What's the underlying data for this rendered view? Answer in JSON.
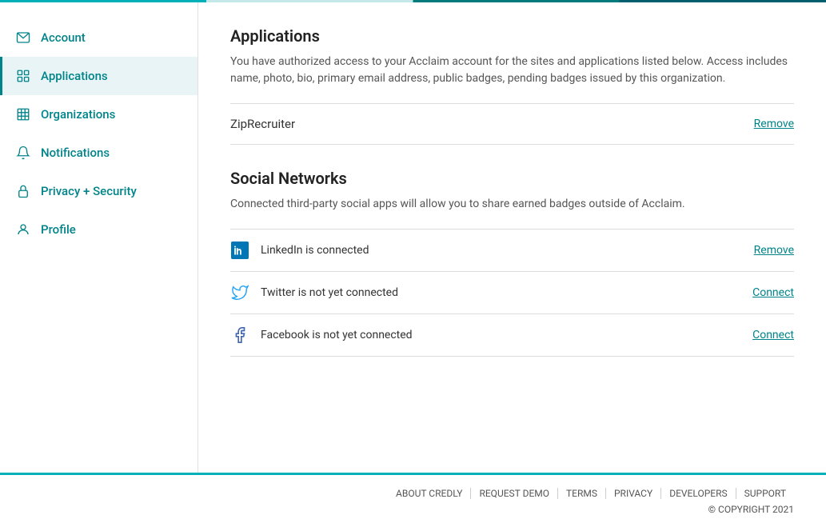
{
  "sidebar": {
    "items": [
      {
        "label": "Account",
        "icon": "mail-icon",
        "active": false,
        "id": "account"
      },
      {
        "label": "Applications",
        "icon": "grid-icon",
        "active": true,
        "id": "applications"
      },
      {
        "label": "Organizations",
        "icon": "building-icon",
        "active": false,
        "id": "organizations"
      },
      {
        "label": "Notifications",
        "icon": "bell-icon",
        "active": false,
        "id": "notifications"
      },
      {
        "label": "Privacy + Security",
        "icon": "lock-icon",
        "active": false,
        "id": "privacy-security"
      },
      {
        "label": "Profile",
        "icon": "user-icon",
        "active": false,
        "id": "profile"
      }
    ]
  },
  "main": {
    "applications_title": "Applications",
    "applications_desc": "You have authorized access to your Acclaim account for the sites and applications listed below. Access includes name, photo, bio, primary email address, public badges, pending badges issued by this organization.",
    "authorized_apps": [
      {
        "name": "ZipRecruiter",
        "action": "Remove"
      }
    ],
    "social_networks_title": "Social Networks",
    "social_networks_desc": "Connected third-party social apps will allow you to share earned badges outside of Acclaim.",
    "social_items": [
      {
        "platform": "LinkedIn",
        "status": "LinkedIn is connected",
        "action": "Remove",
        "connected": true
      },
      {
        "platform": "Twitter",
        "status": "Twitter is not yet connected",
        "action": "Connect",
        "connected": false
      },
      {
        "platform": "Facebook",
        "status": "Facebook is not yet connected",
        "action": "Connect",
        "connected": false
      }
    ]
  },
  "footer": {
    "links": [
      {
        "label": "ABOUT CREDLY"
      },
      {
        "label": "REQUEST DEMO"
      },
      {
        "label": "TERMS"
      },
      {
        "label": "PRIVACY"
      },
      {
        "label": "DEVELOPERS"
      },
      {
        "label": "SUPPORT"
      }
    ],
    "copyright": "© COPYRIGHT 2021"
  },
  "accent_color": "#00848a"
}
